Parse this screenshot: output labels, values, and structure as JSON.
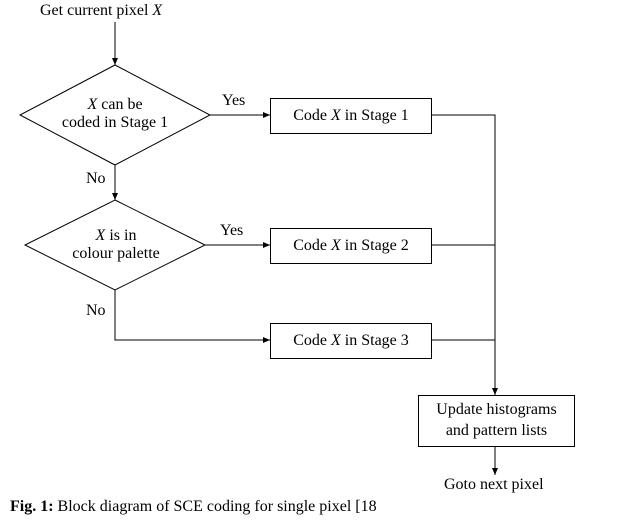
{
  "nodes": {
    "start": "Get current pixel ",
    "start_var": "X",
    "decision1_var": "X",
    "decision1_line1": " can be",
    "decision1_line2": "coded in Stage 1",
    "decision2_var": "X",
    "decision2_line1": " is in",
    "decision2_line2": "colour palette",
    "process1_pre": "Code ",
    "process1_var": "X",
    "process1_post": " in Stage 1",
    "process2_pre": "Code ",
    "process2_var": "X",
    "process2_post": " in Stage 2",
    "process3_pre": "Code ",
    "process3_var": "X",
    "process3_post": " in Stage 3",
    "update_line1": "Update histograms",
    "update_line2": "and pattern lists",
    "goto": "Goto next pixel"
  },
  "edges": {
    "yes": "Yes",
    "no": "No"
  },
  "caption": {
    "prefix": "Fig. 1:",
    "text": "  Block diagram of SCE coding for single pixel [18"
  }
}
